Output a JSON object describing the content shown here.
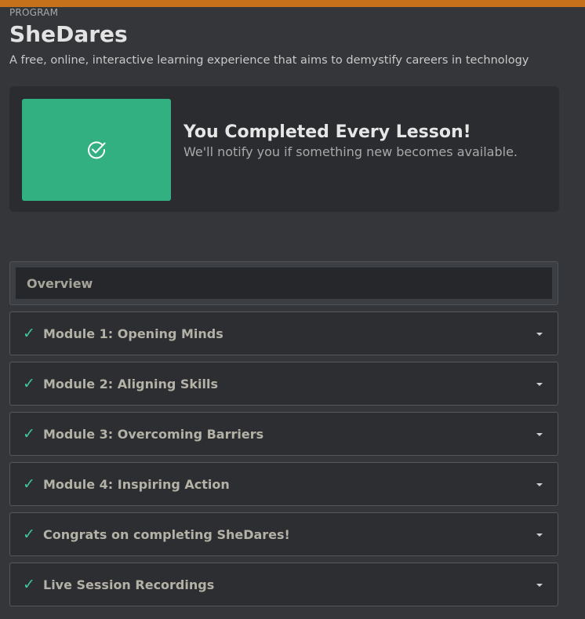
{
  "colors": {
    "accent_bar": "#c5711c",
    "success": "#32b082",
    "check": "#3fc79a"
  },
  "program": {
    "eyebrow": "PROGRAM",
    "title": "SheDares",
    "subtitle": "A free, online, interactive learning experience that aims to demystify careers in technology"
  },
  "completion": {
    "icon": "check-circle-icon",
    "heading": "You Completed Every Lesson!",
    "message": "We'll notify you if something new becomes available."
  },
  "sections": {
    "overview_label": "Overview",
    "items": [
      {
        "label": "Module 1: Opening Minds",
        "completed": true
      },
      {
        "label": "Module 2: Aligning Skills",
        "completed": true
      },
      {
        "label": "Module 3: Overcoming Barriers",
        "completed": true
      },
      {
        "label": "Module 4: Inspiring Action",
        "completed": true
      },
      {
        "label": "Congrats on completing SheDares!",
        "completed": true
      },
      {
        "label": "Live Session Recordings",
        "completed": true
      }
    ],
    "check_glyph": "✓"
  }
}
